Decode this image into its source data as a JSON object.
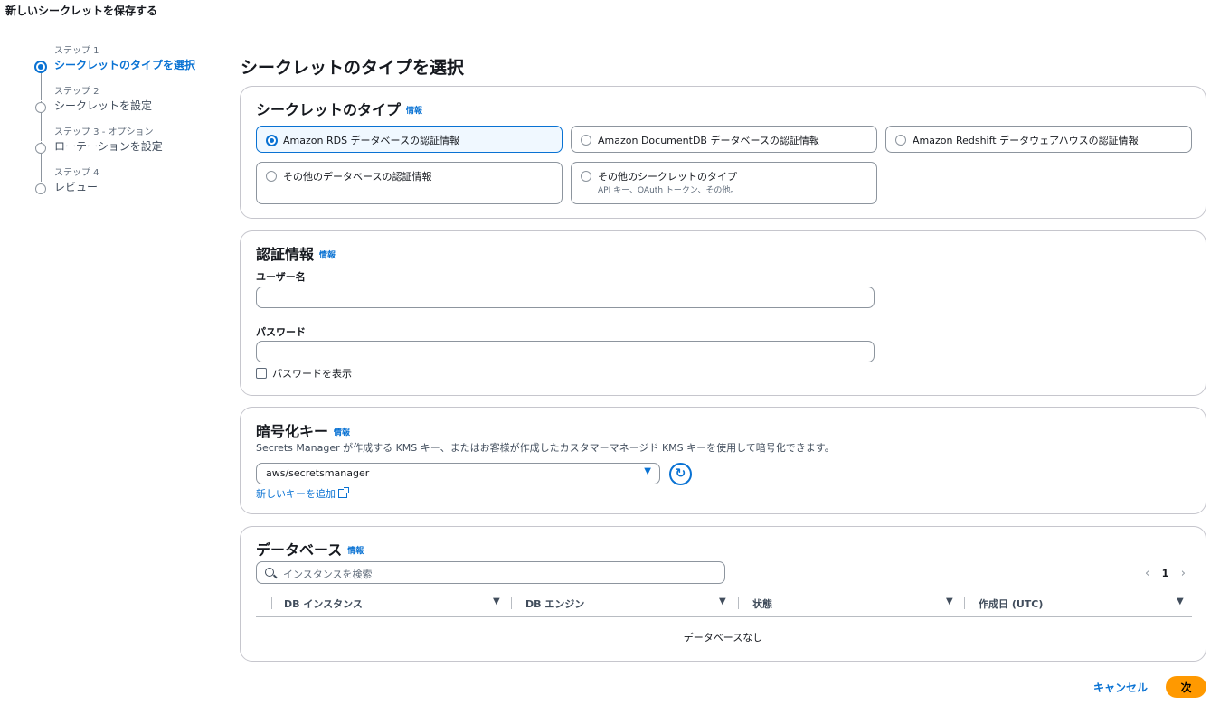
{
  "header": {
    "title": "新しいシークレットを保存する"
  },
  "steps": [
    {
      "num": "ステップ 1",
      "label": "シークレットのタイプを選択",
      "active": true
    },
    {
      "num": "ステップ 2",
      "label": "シークレットを設定"
    },
    {
      "num": "ステップ 3 - オプション",
      "label": "ローテーションを設定"
    },
    {
      "num": "ステップ 4",
      "label": "レビュー"
    }
  ],
  "page_title": "シークレットのタイプを選択",
  "secret_type": {
    "heading": "シークレットのタイプ",
    "info": "情報",
    "options": [
      {
        "label": "Amazon RDS データベースの認証情報",
        "selected": true
      },
      {
        "label": "Amazon DocumentDB データベースの認証情報"
      },
      {
        "label": "Amazon Redshift データウェアハウスの認証情報"
      },
      {
        "label": "その他のデータベースの認証情報"
      },
      {
        "label": "その他のシークレットのタイプ",
        "desc": "API キー、OAuth トークン、その他。"
      }
    ]
  },
  "credentials": {
    "heading": "認証情報",
    "info": "情報",
    "username_label": "ユーザー名",
    "username_value": "",
    "password_label": "パスワード",
    "password_value": "",
    "show_password_label": "パスワードを表示"
  },
  "encryption": {
    "heading": "暗号化キー",
    "info": "情報",
    "description": "Secrets Manager が作成する KMS キー、またはお客様が作成したカスタマーマネージド KMS キーを使用して暗号化できます。",
    "selected_key": "aws/secretsmanager",
    "add_key_link": "新しいキーを追加"
  },
  "database": {
    "heading": "データベース",
    "info": "情報",
    "search_placeholder": "インスタンスを検索",
    "page": "1",
    "columns": [
      "DB インスタンス",
      "DB エンジン",
      "状態",
      "作成日 (UTC)"
    ],
    "empty_text": "データベースなし"
  },
  "footer": {
    "cancel_label": "キャンセル",
    "next_label": "次"
  },
  "colors": {
    "accent": "#0972d3",
    "primary_button": "#ff9900"
  }
}
